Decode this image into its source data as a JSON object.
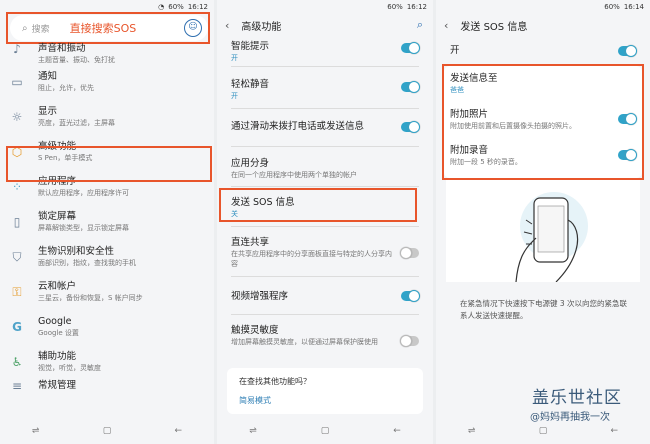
{
  "status": {
    "time1": "16:12",
    "time2": "16:12",
    "time3": "16:14",
    "battery": "60%"
  },
  "panel1": {
    "search_placeholder": "搜索",
    "annotation": "直接搜索SOS",
    "items": [
      {
        "title": "声音和振动",
        "sub": "主题音量、振动、免打扰"
      },
      {
        "title": "通知",
        "sub": "阻止，允许，优先"
      },
      {
        "title": "显示",
        "sub": "亮度，蓝光过滤，主屏幕"
      },
      {
        "title": "高级功能",
        "sub": "S Pen，单手模式"
      },
      {
        "title": "应用程序",
        "sub": "默认应用程序，应用程序许可"
      },
      {
        "title": "锁定屏幕",
        "sub": "屏幕解锁类型，显示锁定屏幕"
      },
      {
        "title": "生物识别和安全性",
        "sub": "面部识别，指纹，查找我的手机"
      },
      {
        "title": "云和帐户",
        "sub": "三星云，备份和恢复，S 帐户同步"
      },
      {
        "title": "Google",
        "sub": "Google 设置"
      },
      {
        "title": "辅助功能",
        "sub": "视觉，听觉，灵敏度"
      },
      {
        "title": "常规管理",
        "sub": ""
      }
    ]
  },
  "panel2": {
    "title": "高级功能",
    "rows": [
      {
        "title": "智能提示",
        "sub": "开",
        "toggle": "on"
      },
      {
        "title": "轻松静音",
        "sub": "开",
        "toggle": "on"
      },
      {
        "title": "通过滑动来拨打电话或发送信息",
        "sub": "",
        "toggle": "on"
      },
      {
        "title": "应用分身",
        "sub": "在同一个应用程序中使用两个单独的帐户",
        "toggle": ""
      },
      {
        "title": "发送 SOS 信息",
        "sub": "关",
        "toggle": ""
      },
      {
        "title": "直连共享",
        "sub": "在共享应用程序中的分享面板直接与特定的人分享内容",
        "toggle": "off"
      },
      {
        "title": "视频增强程序",
        "sub": "",
        "toggle": "on"
      },
      {
        "title": "触摸灵敏度",
        "sub": "增加屏幕触摸灵敏度，以便通过屏幕保护膜使用",
        "toggle": "off"
      }
    ],
    "card_title": "在查找其他功能吗？",
    "card_link": "简易模式"
  },
  "panel3": {
    "title": "发送 SOS 信息",
    "master_label": "开",
    "rows": [
      {
        "title": "发送信息至",
        "sub": "爸爸",
        "toggle": ""
      },
      {
        "title": "附加照片",
        "sub": "附加使用前置和后置摄像头拍摄的照片。",
        "toggle": "on"
      },
      {
        "title": "附加录音",
        "sub": "附加一段 5 秒的录音。",
        "toggle": "on"
      }
    ],
    "description": "在紧急情况下快速按下电源键 3 次以向您的紧急联系人发送快速提醒。"
  },
  "watermark": {
    "line1": "盖乐世社区",
    "line2": "@妈妈再抽我一次"
  },
  "colors": {
    "accent": "#2fa3c9",
    "highlight": "#e8552b"
  }
}
